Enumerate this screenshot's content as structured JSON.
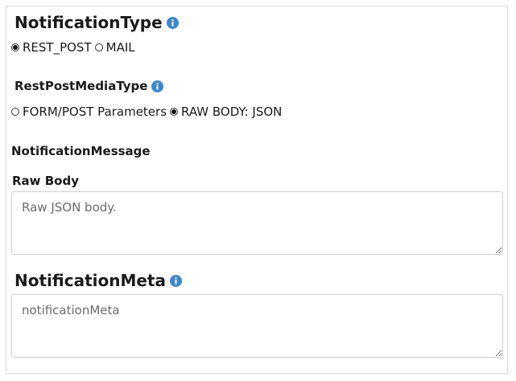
{
  "notification_type": {
    "title": "NotificationType",
    "info_icon": "info-icon",
    "options": [
      {
        "label": "REST_POST",
        "checked": true
      },
      {
        "label": "MAIL",
        "checked": false
      }
    ]
  },
  "rest_post_media_type": {
    "title": "RestPostMediaType",
    "info_icon": "info-icon",
    "options": [
      {
        "label": "FORM/POST Parameters",
        "checked": false
      },
      {
        "label": "RAW BODY: JSON",
        "checked": true
      }
    ]
  },
  "notification_message": {
    "title": "NotificationMessage",
    "raw_body": {
      "label": "Raw Body",
      "value": "",
      "placeholder": "Raw JSON body."
    }
  },
  "notification_meta": {
    "title": "NotificationMeta",
    "info_icon": "info-icon",
    "value": "",
    "placeholder": "notificationMeta"
  },
  "colors": {
    "info_icon": "#3f86c9",
    "border": "#dcdcdc"
  }
}
